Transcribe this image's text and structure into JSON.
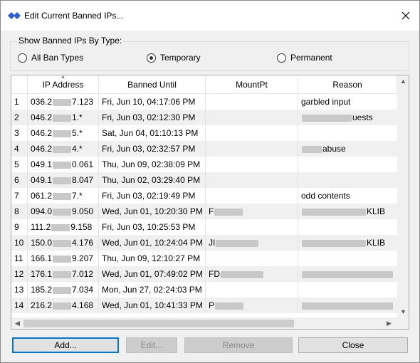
{
  "window": {
    "title": "Edit Current Banned IPs...",
    "close_glyph": "✕"
  },
  "filter": {
    "legend": "Show Banned IPs By Type:",
    "options": [
      {
        "label": "All Ban Types",
        "checked": false
      },
      {
        "label": "Temporary",
        "checked": true
      },
      {
        "label": "Permanent",
        "checked": false
      }
    ]
  },
  "table": {
    "columns": [
      "IP Address",
      "Banned Until",
      "MountPt",
      "Reason"
    ],
    "rows": [
      {
        "num": "1",
        "ip_a": "036.2",
        "ip_b": "7.123",
        "until": "Fri, Jun 10, 04:17:06 PM",
        "mount": "",
        "reason": "garbled input"
      },
      {
        "num": "2",
        "ip_a": "046.2",
        "ip_b": "1.*",
        "until": "Fri, Jun 03, 02:12:30 PM",
        "mount": "",
        "reason": "uests"
      },
      {
        "num": "3",
        "ip_a": "046.2",
        "ip_b": "5.*",
        "until": "Sat, Jun 04, 01:10:13 PM",
        "mount": "",
        "reason": ""
      },
      {
        "num": "4",
        "ip_a": "046.2",
        "ip_b": "4.*",
        "until": "Fri, Jun 03, 02:32:57 PM",
        "mount": "",
        "reason": "abuse"
      },
      {
        "num": "5",
        "ip_a": "049.1",
        "ip_b": "0.061",
        "until": "Thu, Jun 09, 02:38:09 PM",
        "mount": "",
        "reason": ""
      },
      {
        "num": "6",
        "ip_a": "049.1",
        "ip_b": "8.047",
        "until": "Thu, Jun 02, 03:29:40 PM",
        "mount": "",
        "reason": ""
      },
      {
        "num": "7",
        "ip_a": "061.2",
        "ip_b": "7.*",
        "until": "Fri, Jun 03, 02:19:49 PM",
        "mount": "",
        "reason": "odd contents"
      },
      {
        "num": "8",
        "ip_a": "094.0",
        "ip_b": "9.050",
        "until": "Wed, Jun 01, 10:20:30 PM",
        "mount": "F",
        "reason": "KLIB"
      },
      {
        "num": "9",
        "ip_a": "111.2",
        "ip_b": "9.158",
        "until": "Fri, Jun 03, 10:25:53 PM",
        "mount": "",
        "reason": ""
      },
      {
        "num": "10",
        "ip_a": "150.0",
        "ip_b": "4.176",
        "until": "Wed, Jun 01, 10:24:04 PM",
        "mount": "JI",
        "reason": "KLIB"
      },
      {
        "num": "11",
        "ip_a": "166.1",
        "ip_b": "9.207",
        "until": "Thu, Jun 09, 12:10:27 PM",
        "mount": "",
        "reason": ""
      },
      {
        "num": "12",
        "ip_a": "176.1",
        "ip_b": "7.012",
        "until": "Wed, Jun 01, 07:49:02 PM",
        "mount": "FD",
        "reason": ""
      },
      {
        "num": "13",
        "ip_a": "185.2",
        "ip_b": "7.034",
        "until": "Mon, Jun 27, 02:24:03 PM",
        "mount": "",
        "reason": ""
      },
      {
        "num": "14",
        "ip_a": "216.2",
        "ip_b": "4.168",
        "until": "Wed, Jun 01, 10:41:33 PM",
        "mount": "P",
        "reason": ""
      }
    ]
  },
  "buttons": {
    "add": "Add...",
    "edit": "Edit...",
    "remove": "Remove",
    "close": "Close"
  },
  "colors": {
    "accent": "#0078d7",
    "icon": "#2b5fd9"
  }
}
